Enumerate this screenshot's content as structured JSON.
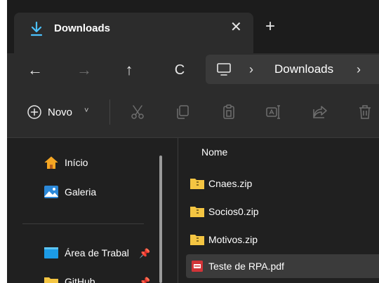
{
  "tab": {
    "title": "Downloads",
    "close": "✕",
    "new_tab": "+"
  },
  "nav": {
    "back": "←",
    "forward": "→",
    "up": "↑",
    "refresh": "C"
  },
  "address": {
    "crumbs": [
      "Downloads"
    ],
    "separator": "›"
  },
  "command_bar": {
    "new_label": "Novo",
    "new_chevron": "˅"
  },
  "sidebar": {
    "items": [
      {
        "label": "Início",
        "icon": "home-icon"
      },
      {
        "label": "Galeria",
        "icon": "gallery-icon"
      },
      {
        "label": "Área de Trabal",
        "icon": "desktop-icon",
        "pinned": true
      },
      {
        "label": "GitHub",
        "icon": "folder-icon",
        "pinned": true
      }
    ]
  },
  "files": {
    "column_header": "Nome",
    "rows": [
      {
        "name": "Cnaes.zip",
        "icon": "zip-folder-icon"
      },
      {
        "name": "Socios0.zip",
        "icon": "zip-folder-icon"
      },
      {
        "name": "Motivos.zip",
        "icon": "zip-folder-icon"
      },
      {
        "name": "Teste de RPA.pdf",
        "icon": "pdf-icon",
        "selected": true
      }
    ]
  },
  "colors": {
    "background": "#202020",
    "toolbar": "#2c2c2c",
    "accent_download": "#4cc2ff",
    "folder": "#f4c542",
    "pdf": "#d13438"
  }
}
